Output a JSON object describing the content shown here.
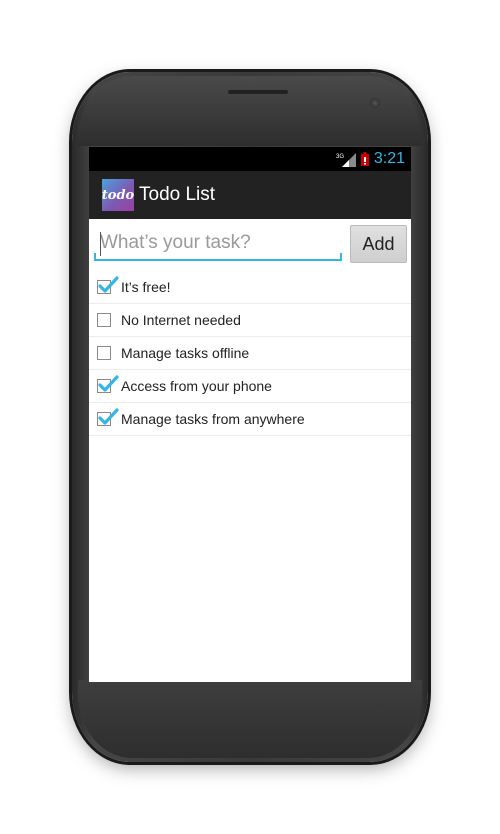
{
  "status_bar": {
    "network_label": "3G",
    "time": "3:21",
    "colors": {
      "accent": "#33b5e5",
      "battery": "#cc0000"
    }
  },
  "action_bar": {
    "app_icon_text": "todo",
    "title": "Todo List"
  },
  "new_task": {
    "placeholder": "What’s your task?",
    "value": "",
    "add_label": "Add"
  },
  "tasks": [
    {
      "label": "It’s free!",
      "checked": true
    },
    {
      "label": "No Internet needed",
      "checked": false
    },
    {
      "label": "Manage tasks offline",
      "checked": false
    },
    {
      "label": "Access from your phone",
      "checked": true
    },
    {
      "label": "Manage tasks from anywhere",
      "checked": true
    }
  ]
}
